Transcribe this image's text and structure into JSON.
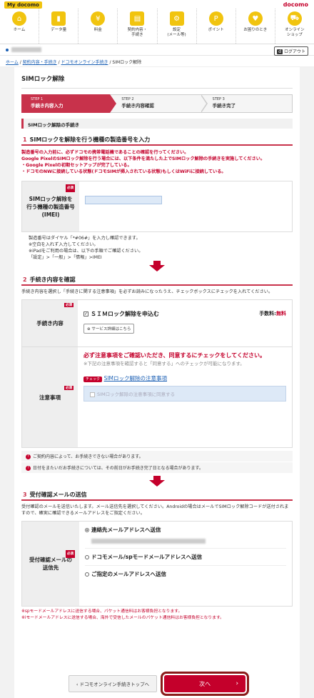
{
  "header": {
    "my_docomo": "My docomo",
    "brand": "docomo",
    "nav": [
      {
        "label": "ホーム",
        "icon": "home-icon",
        "glyph": "⌂"
      },
      {
        "label": "データ量",
        "icon": "data-chart-icon",
        "glyph": "▮"
      },
      {
        "label": "料金",
        "icon": "yen-icon",
        "glyph": "¥"
      },
      {
        "label": "契約内容・\n手続き",
        "icon": "contract-icon",
        "glyph": "▤"
      },
      {
        "label": "設定\n(メール等)",
        "icon": "settings-icon",
        "glyph": "⚙"
      },
      {
        "label": "ポイント",
        "icon": "point-icon",
        "glyph": "P"
      },
      {
        "label": "お困りのとき",
        "icon": "heart-icon",
        "glyph": "♥"
      },
      {
        "label": "オンライン\nショップ",
        "icon": "cart-icon",
        "glyph": "⛟"
      }
    ],
    "logout": "ログアウト",
    "logout_badge": "d"
  },
  "breadcrumb": {
    "items": [
      "ホーム",
      "契約内容・手続き",
      "ドコモオンライン手続き",
      "SIMロック解除"
    ]
  },
  "page": {
    "title": "SIMロック解除",
    "steps": [
      {
        "num": "STEP 1",
        "label": "手続き内容入力"
      },
      {
        "num": "STEP 2",
        "label": "手続き内容確認"
      },
      {
        "num": "STEP 3",
        "label": "手続き完了"
      }
    ],
    "subhead": "SIMロック解除の手続き"
  },
  "section1": {
    "num": "1",
    "title": "SIMロックを解除を行う機種の製造番号を入力",
    "red_lines": [
      "製造番号の入力前に、必ずドコモの携帯電話機であることの確認を行ってください。",
      "Google PixelのSIMロック解除を行う場合には、以下条件を満たした上でSIMロック解除の手続きを実施してください。",
      "・Google Pixelの初期セットアップが完了している。",
      "・ドコモのNWに接続している状態(ドコモSIMが挿入されている状態)もしくはWiFiに接続している。"
    ],
    "required": "必須",
    "label": "SIMロック解除を行う機種の製造番号(IMEI)",
    "notes": [
      "製造番号はダイヤル「*#06#」を入力し確認できます。",
      "※空白を入れず入力してください。",
      "※iPadをご利用の場合は、以下の手順でご確認ください。",
      "「設定」>「一般」>「情報」>IMEI"
    ]
  },
  "section2": {
    "num": "2",
    "title": "手続き内容を確認",
    "intro": "手続き内容を選択し「手続きに関する注意事項」を必ずお読みになったうえ、チェックボックスにチェックを入れてください。",
    "row1": {
      "label": "手続き内容",
      "required": "必須",
      "option": "ＳＩＭロック解除を申込む",
      "fee_label": "手数料:",
      "fee_value": "無料",
      "service_button": "サービス詳細はこちら"
    },
    "row2": {
      "label": "注意事項",
      "required": "必須",
      "notice_bold": "必ず注意事項をご確認いただき、同意するにチェックをしてください。",
      "notice_gray": "※下記の注意事項を確認すると「同意する」へのチェックが可能になります。",
      "check_tag": "チェック",
      "link": "SIMロック解除の注意事項",
      "agree": "SIMロック解除の注意事項に同意する"
    },
    "alerts": [
      "ご契約内容によって、お手続きできない場合があります。",
      "日付をまたいだお手続きについては、その前日がお手続き完了日となる場合があります。"
    ]
  },
  "section3": {
    "num": "3",
    "title": "受付確認メールの送信",
    "intro": "受付確認のメールを送信いたします。メール送信先を選択してください。Androidの場合はメールでSIMロック解除コードが送付されますので、確実に確認できるメールアドレスをご指定ください。",
    "label": "受付確認メールの送信先",
    "required": "必須",
    "options": [
      "連絡先メールアドレスへ送信",
      "ドコモメール/spモードメールアドレスへ送信",
      "ご指定のメールアドレスへ送信"
    ],
    "footnotes": [
      "※spモードメールアドレスに送信する場合、パケット通信料はお客様負担となります。",
      "※iモードメールアドレスに送信する場合、海外で受信したメールのパケット通信料はお客様負担となります。"
    ]
  },
  "buttons": {
    "back": "ドコモオンライン手続きトップへ",
    "next": "次へ"
  }
}
